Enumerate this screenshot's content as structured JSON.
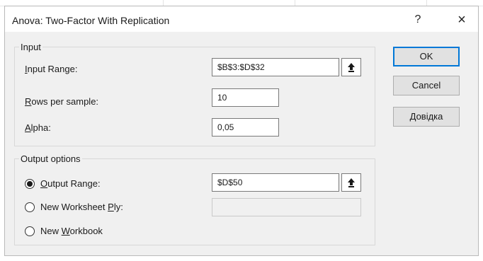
{
  "window": {
    "title": "Anova: Two-Factor With Replication",
    "help_symbol": "?",
    "close_symbol": "×"
  },
  "input_group": {
    "legend": "Input",
    "input_range": {
      "label_prefix": "",
      "label_accel": "I",
      "label_rest": "nput Range:",
      "value": "$B$3:$D$32"
    },
    "rows_per_sample": {
      "label_accel": "R",
      "label_rest": "ows per sample:",
      "value": "10"
    },
    "alpha": {
      "label_accel": "A",
      "label_rest": "lpha:",
      "value": "0,05"
    }
  },
  "output_group": {
    "legend": "Output options",
    "output_range": {
      "label_accel": "O",
      "label_rest": "utput Range:",
      "value": "$D$50",
      "selected": true
    },
    "new_worksheet": {
      "label_pre": "New Worksheet ",
      "label_accel": "P",
      "label_rest": "ly:",
      "value": "",
      "selected": false
    },
    "new_workbook": {
      "label_pre": "New ",
      "label_accel": "W",
      "label_rest": "orkbook",
      "selected": false
    }
  },
  "buttons": {
    "ok": "OK",
    "cancel": "Cancel",
    "help_pre": "",
    "help_accel": "Д",
    "help_rest": "овідка"
  },
  "icons": {
    "range_picker": "upload-arrow-icon"
  }
}
